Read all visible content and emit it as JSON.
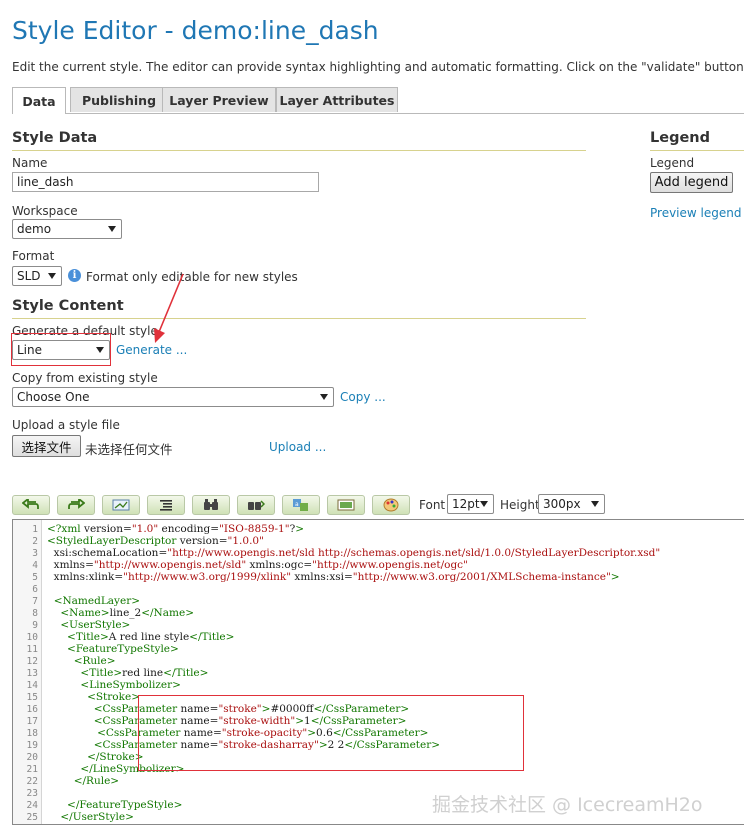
{
  "page": {
    "title": "Style Editor - demo:line_dash",
    "description": "Edit the current style. The editor can provide syntax highlighting and automatic formatting. Click on the \"validate\" button to verify the style"
  },
  "tabs": [
    {
      "label": "Data",
      "active": true
    },
    {
      "label": "Publishing",
      "active": false
    },
    {
      "label": "Layer Preview",
      "active": false
    },
    {
      "label": "Layer Attributes",
      "active": false
    }
  ],
  "style_data": {
    "heading": "Style Data",
    "name_label": "Name",
    "name_value": "line_dash",
    "workspace_label": "Workspace",
    "workspace_value": "demo",
    "format_label": "Format",
    "format_value": "SLD",
    "format_note": "Format only editable for new styles"
  },
  "style_content": {
    "heading": "Style Content",
    "default_label": "Generate a default style",
    "default_value": "Line",
    "generate_link": "Generate ...",
    "copy_label": "Copy from existing style",
    "copy_value": "Choose One",
    "copy_link": "Copy ...",
    "upload_label": "Upload a style file",
    "choose_file_button": "选择文件",
    "no_file_text": "未选择任何文件",
    "upload_link": "Upload ..."
  },
  "legend": {
    "heading": "Legend",
    "label": "Legend",
    "add_button": "Add legend",
    "preview_link": "Preview legend"
  },
  "toolbar": {
    "icons": [
      "undo-icon",
      "redo-icon",
      "goto-line-icon",
      "reindent-icon",
      "search-icon",
      "replace-icon",
      "format-icon",
      "image-icon",
      "color-picker-icon"
    ],
    "font_label": "Font",
    "font_value": "12pt",
    "height_label": "Height",
    "height_value": "300px"
  },
  "editor": {
    "lines": [
      {
        "n": "1",
        "t": "<?xml version=\"1.0\" encoding=\"ISO-8859-1\"?>"
      },
      {
        "n": "2",
        "t": "<StyledLayerDescriptor version=\"1.0.0\""
      },
      {
        "n": "3",
        "t": "  xsi:schemaLocation=\"http://www.opengis.net/sld http://schemas.opengis.net/sld/1.0.0/StyledLayerDescriptor.xsd\""
      },
      {
        "n": "4",
        "t": "  xmlns=\"http://www.opengis.net/sld\" xmlns:ogc=\"http://www.opengis.net/ogc\""
      },
      {
        "n": "5",
        "t": "  xmlns:xlink=\"http://www.w3.org/1999/xlink\" xmlns:xsi=\"http://www.w3.org/2001/XMLSchema-instance\">"
      },
      {
        "n": "6",
        "t": ""
      },
      {
        "n": "7",
        "t": "  <NamedLayer>"
      },
      {
        "n": "8",
        "t": "    <Name>line_2</Name>"
      },
      {
        "n": "9",
        "t": "    <UserStyle>"
      },
      {
        "n": "10",
        "t": "      <Title>A red line style</Title>"
      },
      {
        "n": "11",
        "t": "      <FeatureTypeStyle>"
      },
      {
        "n": "12",
        "t": "        <Rule>"
      },
      {
        "n": "13",
        "t": "          <Title>red line</Title>"
      },
      {
        "n": "14",
        "t": "          <LineSymbolizer>"
      },
      {
        "n": "15",
        "t": "            <Stroke>"
      },
      {
        "n": "16",
        "t": "              <CssParameter name=\"stroke\">#0000ff</CssParameter>"
      },
      {
        "n": "17",
        "t": "              <CssParameter name=\"stroke-width\">1</CssParameter>"
      },
      {
        "n": "18",
        "t": "               <CssParameter name=\"stroke-opacity\">0.6</CssParameter>"
      },
      {
        "n": "19",
        "t": "              <CssParameter name=\"stroke-dasharray\">2 2</CssParameter>"
      },
      {
        "n": "20",
        "t": "            </Stroke>"
      },
      {
        "n": "21",
        "t": "          </LineSymbolizer>"
      },
      {
        "n": "22",
        "t": "        </Rule>"
      },
      {
        "n": "23",
        "t": ""
      },
      {
        "n": "24",
        "t": "      </FeatureTypeStyle>"
      },
      {
        "n": "25",
        "t": "    </UserStyle>"
      }
    ]
  },
  "watermark": "掘金技术社区 @ IcecreamH2o",
  "colors": {
    "title": "#1f77b4",
    "link": "#1a7fb6",
    "annotation": "#e0313a",
    "xml_tag": "#117700",
    "xml_string": "#aa1111"
  }
}
